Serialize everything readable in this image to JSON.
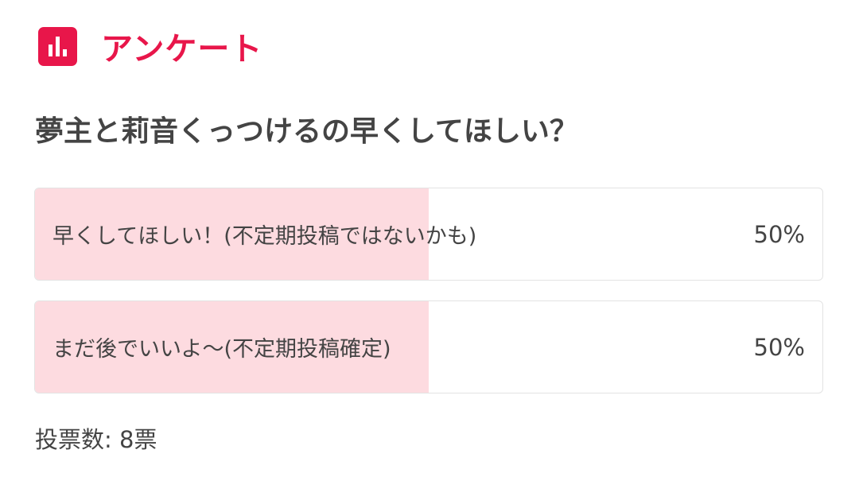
{
  "header": {
    "title": "アンケート",
    "icon": "poll-chart-icon",
    "accent_color": "#e8164a"
  },
  "poll": {
    "question": "夢主と莉音くっつけるの早くしてほしい？",
    "fill_color": "#fddbe0",
    "options": [
      {
        "label": "早くしてほしい！(不定期投稿ではないかも)",
        "percent_text": "50%",
        "share": 0.5
      },
      {
        "label": "まだ後でいいよ〜(不定期投稿確定)",
        "percent_text": "50%",
        "share": 0.5
      }
    ],
    "vote_count": "投票数: 8票"
  }
}
